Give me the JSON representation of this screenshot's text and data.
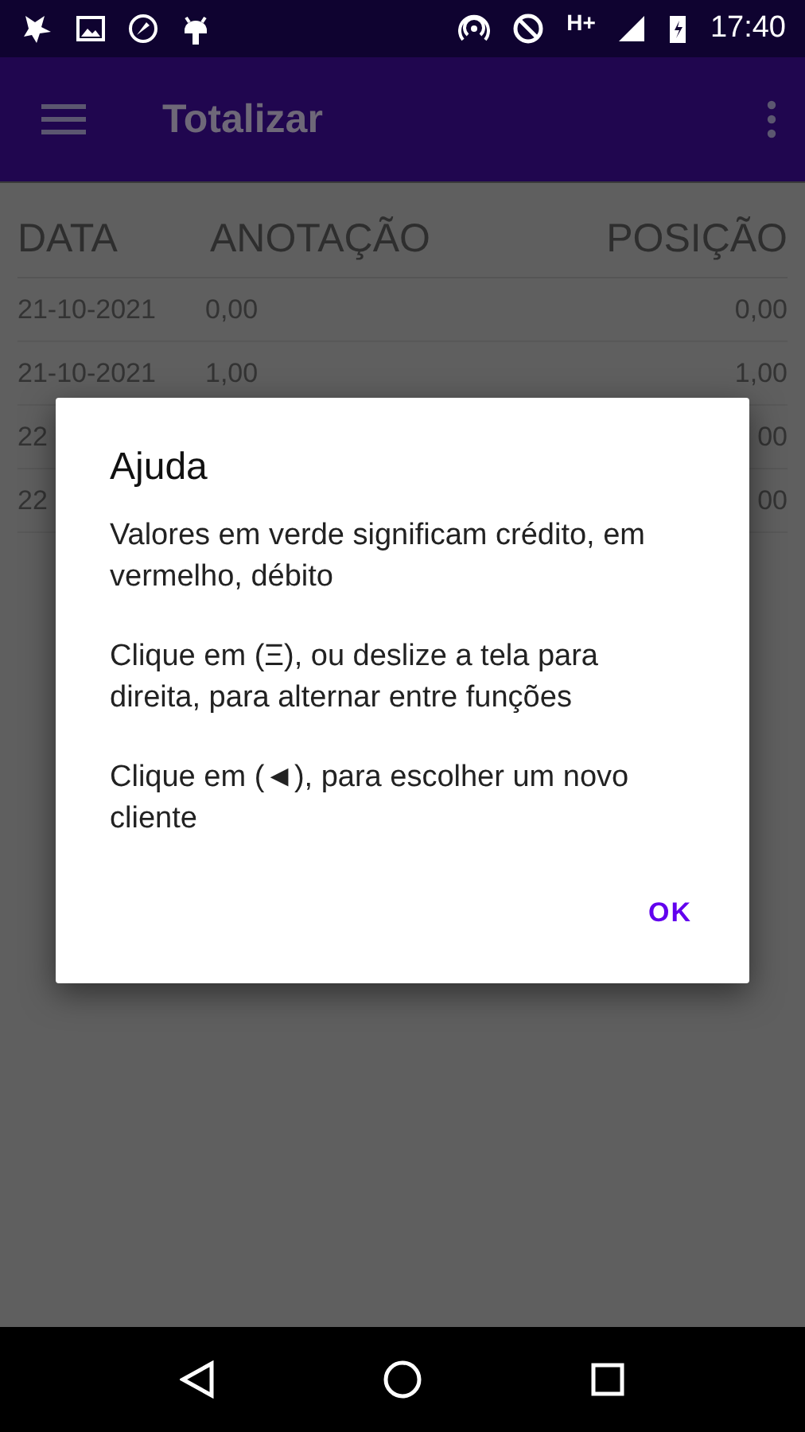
{
  "status_bar": {
    "network": "H+",
    "time": "17:40"
  },
  "app_bar": {
    "title": "Totalizar"
  },
  "table": {
    "columns": [
      "DATA",
      "ANOTAÇÃO",
      "POSIÇÃO"
    ],
    "rows": [
      {
        "cells": [
          "21-10-2021",
          "0,00",
          "0,00"
        ]
      },
      {
        "cells": [
          "21-10-2021",
          "1,00",
          "1,00"
        ]
      },
      {
        "cells": [
          "22",
          "",
          "00"
        ]
      },
      {
        "cells": [
          "22",
          "",
          "00"
        ]
      }
    ]
  },
  "dialog": {
    "title": "Ajuda",
    "paragraphs": [
      "Valores em verde significam crédito, em vermelho, débito",
      "Clique em (Ξ), ou deslize a tela para direita, para alternar entre funções",
      "Clique em (◄), para escolher um novo cliente"
    ],
    "button": "OK"
  }
}
